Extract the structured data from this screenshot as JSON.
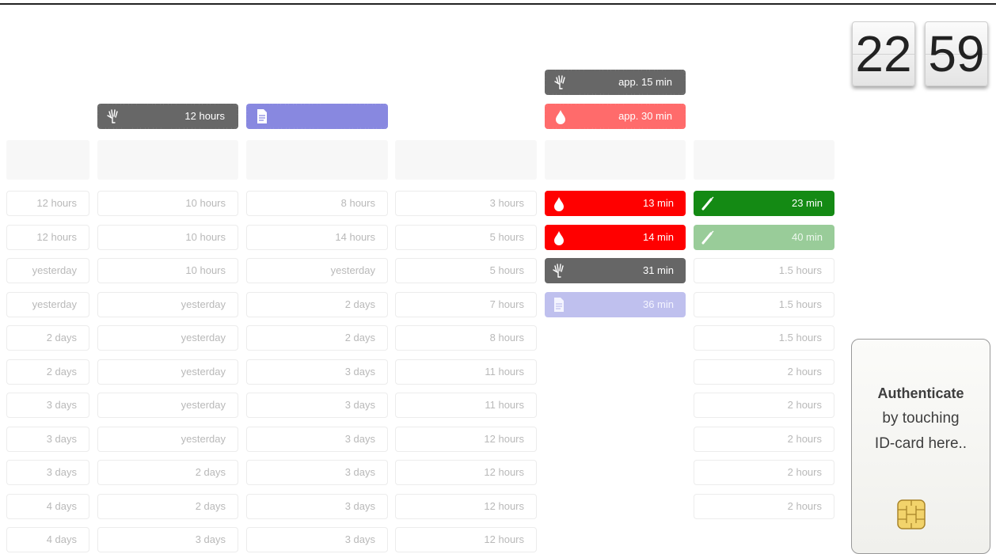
{
  "clock": {
    "hours": "22",
    "minutes": "59"
  },
  "pending": {
    "col1": [
      {
        "icon": "xray-hand-icon",
        "label": "12 hours",
        "color": "#676767"
      }
    ],
    "col2": [
      {
        "icon": "document-icon",
        "label": "",
        "color": "#8888e0"
      }
    ],
    "col4": [
      {
        "icon": "xray-hand-icon",
        "label": "app. 15 min",
        "color": "#676767"
      },
      {
        "icon": "blood-drop-icon",
        "label": "app. 30 min",
        "color": "#ff6b6b"
      }
    ]
  },
  "columns": [
    [
      "12 hours",
      "12 hours",
      "yesterday",
      "yesterday",
      "2 days",
      "2 days",
      "3 days",
      "3 days",
      "3 days",
      "4 days",
      "4 days"
    ],
    [
      "10 hours",
      "10 hours",
      "10 hours",
      "yesterday",
      "yesterday",
      "yesterday",
      "yesterday",
      "yesterday",
      "2 days",
      "2 days",
      "3 days"
    ],
    [
      "8 hours",
      "14 hours",
      "yesterday",
      "2 days",
      "2 days",
      "3 days",
      "3 days",
      "3 days",
      "3 days",
      "3 days",
      "3 days"
    ],
    [
      "3 hours",
      "5 hours",
      "5 hours",
      "7 hours",
      "8 hours",
      "11 hours",
      "11 hours",
      "12 hours",
      "12 hours",
      "12 hours",
      "12 hours"
    ]
  ],
  "active4": [
    {
      "icon": "blood-drop-icon",
      "label": "13 min",
      "color": "#ff0000"
    },
    {
      "icon": "blood-drop-icon",
      "label": "14 min",
      "color": "#ff0000"
    },
    {
      "icon": "xray-hand-icon",
      "label": "31 min",
      "color": "#666666"
    },
    {
      "icon": "document-icon",
      "label": "36 min",
      "color": "#bfc0ee"
    }
  ],
  "col5": [
    {
      "icon": "syringe-icon",
      "label": "23 min",
      "color": "#148a14"
    },
    {
      "icon": "syringe-icon",
      "label": "40 min",
      "color": "#99cc99"
    },
    {
      "label": "1.5 hours"
    },
    {
      "label": "1.5 hours"
    },
    {
      "label": "1.5 hours"
    },
    {
      "label": "2 hours"
    },
    {
      "label": "2 hours"
    },
    {
      "label": "2 hours"
    },
    {
      "label": "2 hours"
    },
    {
      "label": "2 hours"
    }
  ],
  "auth": {
    "title": "Authenticate",
    "line2": "by touching",
    "line3": "ID-card here.."
  }
}
